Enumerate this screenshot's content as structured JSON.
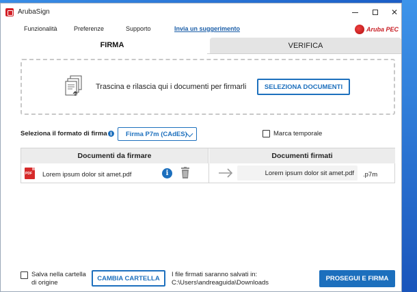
{
  "window": {
    "title": "ArubaSign"
  },
  "menu": {
    "items": [
      "Funzionalità",
      "Preferenze",
      "Supporto"
    ],
    "link": "Invia un suggerimento"
  },
  "brand": {
    "name": "Aruba PEC"
  },
  "tabs": [
    {
      "label": "FIRMA",
      "active": true
    },
    {
      "label": "VERIFICA",
      "active": false
    }
  ],
  "dropzone": {
    "text": "Trascina e rilascia qui i documenti per firmarli",
    "button": "SELEZIONA DOCUMENTI"
  },
  "format": {
    "label": "Seleziona il formato di firma",
    "selected": "Firma P7m (CAdES)",
    "timestamp_label": "Marca temporale",
    "timestamp_checked": false
  },
  "table": {
    "headers": [
      "Documenti da firmare",
      "Documenti firmati"
    ],
    "rows": [
      {
        "source": "Lorem ipsum dolor sit amet.pdf",
        "signed": "Lorem ipsum dolor sit amet.pdf",
        "extension": ".p7m"
      }
    ]
  },
  "footer": {
    "save_origin_line1": "Salva nella cartella",
    "save_origin_line2": "di origine",
    "save_origin_checked": false,
    "change_folder_button": "CAMBIA CARTELLA",
    "save_info_line1": "I file firmati saranno salvati in:",
    "save_info_path": "C:\\Users\\andreaguida\\Downloads",
    "proceed_button": "PROSEGUI E FIRMA"
  },
  "colors": {
    "accent": "#1c6fbd",
    "brand_red": "#c81e24",
    "pdf_red": "#d62a2a"
  }
}
